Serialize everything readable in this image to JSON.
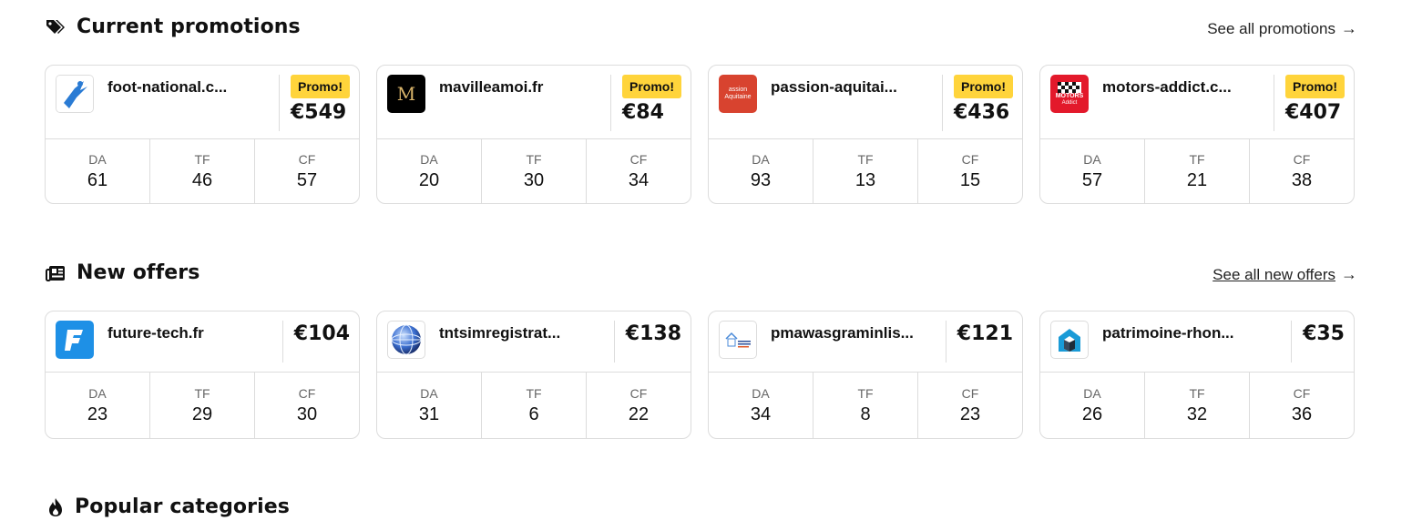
{
  "promotions": {
    "title": "Current promotions",
    "see_all": "See all promotions",
    "cards": [
      {
        "site": "foot-national.c...",
        "badge": "Promo!",
        "price": "€549",
        "da": "61",
        "tf": "46",
        "cf": "57",
        "logo": "foot-national-logo"
      },
      {
        "site": "mavilleamoi.fr",
        "badge": "Promo!",
        "price": "€84",
        "da": "20",
        "tf": "30",
        "cf": "34",
        "logo": "mavilleamoi-logo"
      },
      {
        "site": "passion-aquitai...",
        "badge": "Promo!",
        "price": "€436",
        "da": "93",
        "tf": "13",
        "cf": "15",
        "logo": "passion-aquitaine-logo"
      },
      {
        "site": "motors-addict.c...",
        "badge": "Promo!",
        "price": "€407",
        "da": "57",
        "tf": "21",
        "cf": "38",
        "logo": "motors-addict-logo"
      }
    ]
  },
  "offers": {
    "title": "New offers",
    "see_all": "See all new offers",
    "cards": [
      {
        "site": "future-tech.fr",
        "price": "€104",
        "da": "23",
        "tf": "29",
        "cf": "30",
        "logo": "future-tech-logo"
      },
      {
        "site": "tntsimregistrat...",
        "price": "€138",
        "da": "31",
        "tf": "6",
        "cf": "22",
        "logo": "globe-logo"
      },
      {
        "site": "pmawasgraminlis...",
        "price": "€121",
        "da": "34",
        "tf": "8",
        "cf": "23",
        "logo": "pmawasgramin-logo"
      },
      {
        "site": "patrimoine-rhon...",
        "price": "€35",
        "da": "26",
        "tf": "32",
        "cf": "36",
        "logo": "patrimoine-logo"
      }
    ]
  },
  "metric_labels": {
    "da": "DA",
    "tf": "TF",
    "cf": "CF"
  },
  "categories": {
    "title": "Popular categories"
  },
  "logo_text": {
    "mavilleamoi": "M",
    "passion": "assion Aquitaine",
    "motors": "MOTORS",
    "motors_sub": "Addict"
  },
  "colors": {
    "badge": "#ffd43b",
    "border": "#dcdcdc",
    "text": "#111111"
  }
}
